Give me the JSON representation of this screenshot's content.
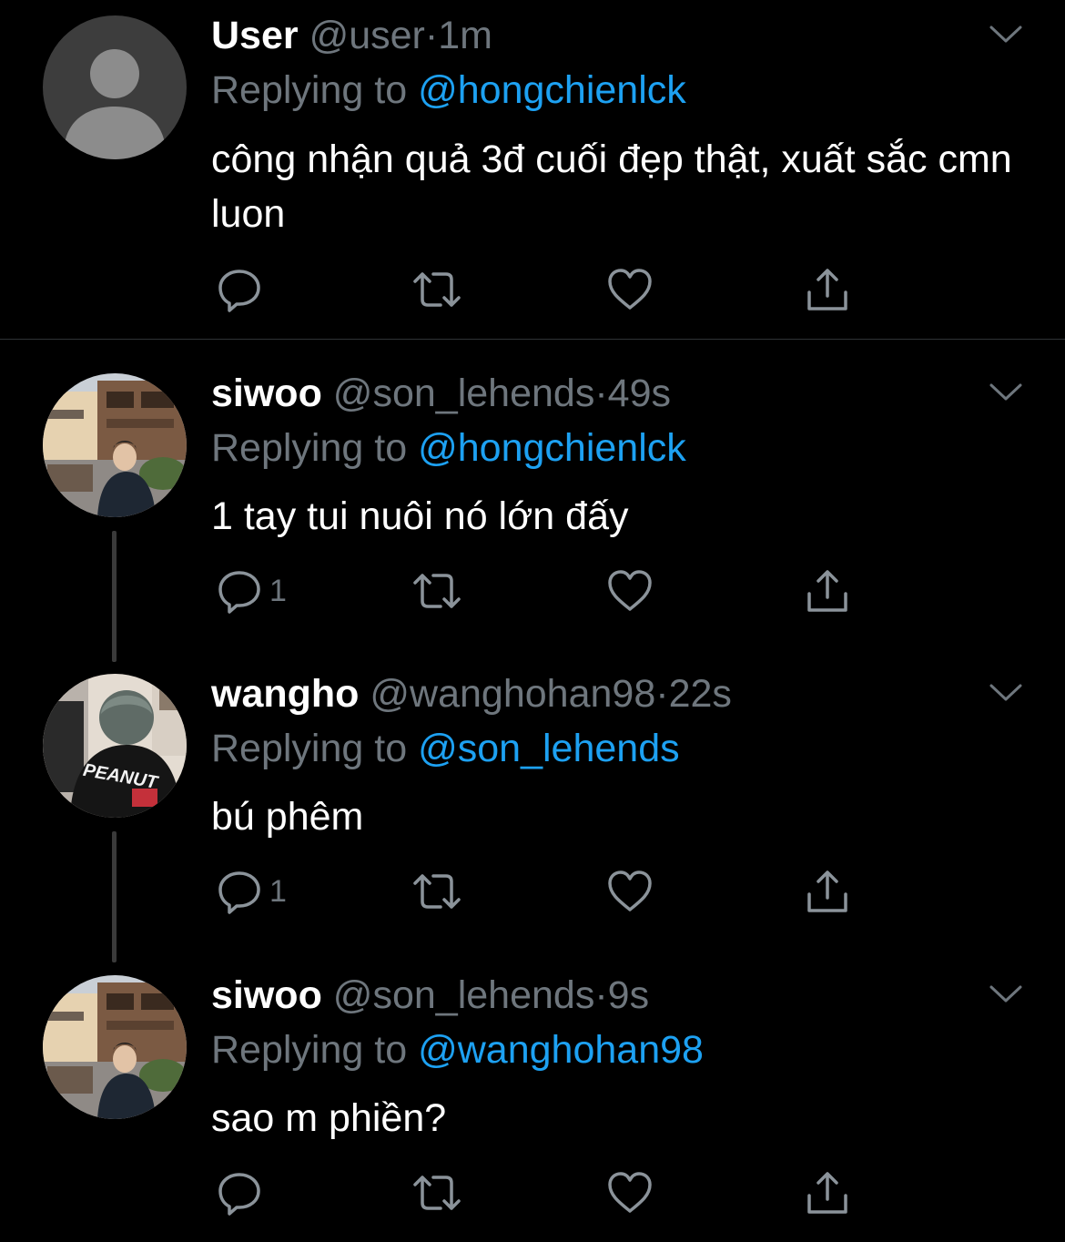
{
  "tweets": [
    {
      "display_name": "User",
      "handle": "@user",
      "time": "1m",
      "replying_prefix": "Replying to",
      "replying_to": "@hongchienlck",
      "text": "công nhận quả 3đ cuối đẹp thật, xuất sắc cmn luon",
      "reply_count": "",
      "avatar": "default-avatar"
    },
    {
      "display_name": "siwoo",
      "handle": "@son_lehends",
      "time": "49s",
      "replying_prefix": "Replying to",
      "replying_to": "@hongchienlck",
      "text": "1 tay tui nuôi nó lớn đấy",
      "reply_count": "1",
      "avatar": "photo-street"
    },
    {
      "display_name": "wangho",
      "handle": "@wanghohan98",
      "time": "22s",
      "replying_prefix": "Replying to",
      "replying_to": "@son_lehends",
      "text": "bú phêm",
      "reply_count": "1",
      "avatar": "photo-jacket",
      "avatar_text": "PEANUT"
    },
    {
      "display_name": "siwoo",
      "handle": "@son_lehends",
      "time": "9s",
      "replying_prefix": "Replying to",
      "replying_to": "@wanghohan98",
      "text": "sao m phiền?",
      "reply_count": "",
      "avatar": "photo-street"
    }
  ],
  "separator": "·",
  "icons": {
    "reply": "reply-icon",
    "retweet": "retweet-icon",
    "like": "heart-icon",
    "share": "share-icon",
    "more": "chevron-down-icon"
  },
  "colors": {
    "background": "#000000",
    "name": "#ffffff",
    "muted": "#6e767d",
    "mention": "#1da1f2",
    "thread_line": "#3a3a3a"
  }
}
